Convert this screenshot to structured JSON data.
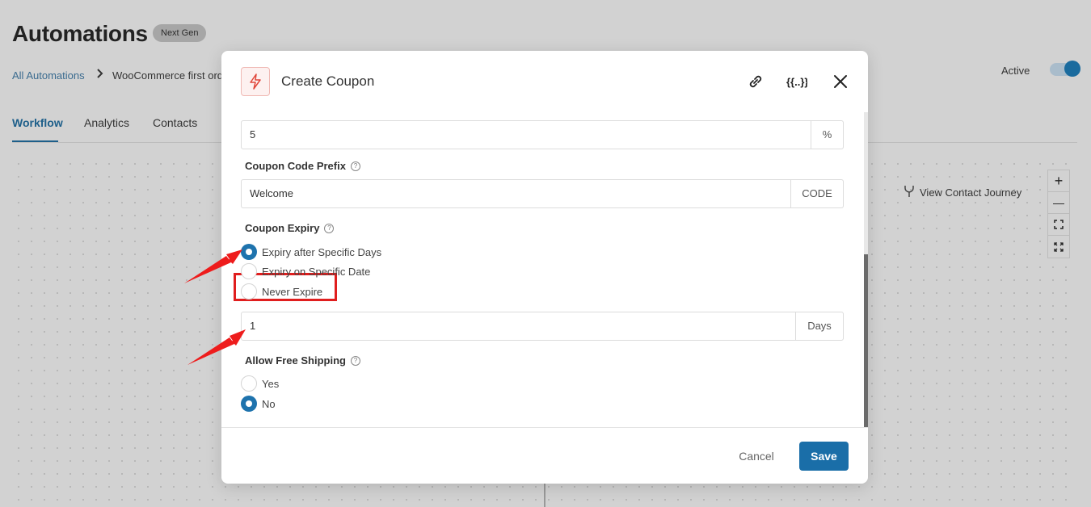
{
  "page": {
    "title": "Automations",
    "badge": "Next Gen",
    "breadcrumb": {
      "root": "All Automations",
      "current": "WooCommerce first ord"
    },
    "status_label": "Active",
    "tabs": [
      "Workflow",
      "Analytics",
      "Contacts"
    ],
    "view_journey": "View Contact Journey",
    "zoom": {
      "in": "+",
      "out": "—"
    }
  },
  "modal": {
    "title": "Create Coupon",
    "discount": {
      "value": "5",
      "suffix": "%"
    },
    "prefix": {
      "label": "Coupon Code Prefix",
      "value": "Welcome",
      "suffix": "CODE"
    },
    "expiry": {
      "label": "Coupon Expiry",
      "options": [
        "Expiry after Specific Days",
        "Expiry on Specific Date",
        "Never Expire"
      ],
      "selected": "Expiry after Specific Days",
      "days_value": "1",
      "days_suffix": "Days"
    },
    "free_shipping": {
      "label": "Allow Free Shipping",
      "options": [
        "Yes",
        "No"
      ],
      "selected": "No"
    },
    "cancel_label": "Cancel",
    "save_label": "Save"
  },
  "colors": {
    "accent": "#1a6ea8",
    "annotation": "#e01e1e",
    "icon_red": "#e0463a"
  },
  "icons": [
    "bolt-icon",
    "link-icon",
    "merge-tags-icon",
    "close-icon",
    "journey-icon",
    "help-icon"
  ]
}
